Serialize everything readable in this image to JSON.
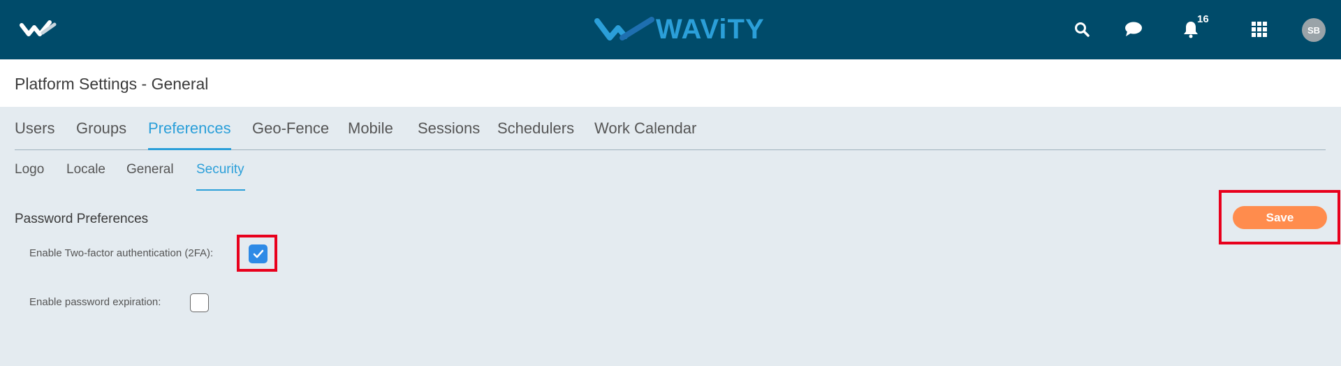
{
  "header": {
    "brand_name": "WAViTY",
    "notification_count": "16",
    "user_initials": "SB",
    "icons": [
      "wavity-logo-icon",
      "search-icon",
      "chat-icon",
      "bell-icon",
      "apps-grid-icon"
    ]
  },
  "page": {
    "title": "Platform Settings - General"
  },
  "tabs": [
    {
      "label": "Users",
      "active": false
    },
    {
      "label": "Groups",
      "active": false
    },
    {
      "label": "Preferences",
      "active": true
    },
    {
      "label": "Geo-Fence",
      "active": false
    },
    {
      "label": "Mobile",
      "active": false
    },
    {
      "label": "Sessions",
      "active": false
    },
    {
      "label": "Schedulers",
      "active": false
    },
    {
      "label": "Work Calendar",
      "active": false
    }
  ],
  "subtabs": [
    {
      "label": "Logo",
      "active": false
    },
    {
      "label": "Locale",
      "active": false
    },
    {
      "label": "General",
      "active": false
    },
    {
      "label": "Security",
      "active": true
    }
  ],
  "security": {
    "section_title": "Password Preferences",
    "fields": [
      {
        "label": "Enable Two-factor authentication (2FA):",
        "checked": true
      },
      {
        "label": "Enable password expiration:",
        "checked": false
      }
    ]
  },
  "actions": {
    "save_label": "Save"
  },
  "colors": {
    "header_bg": "#004b6a",
    "accent": "#2b9fd9",
    "save_button": "#ff8c4d",
    "highlight": "#e8001c",
    "checkbox_checked": "#2d8ae6"
  }
}
